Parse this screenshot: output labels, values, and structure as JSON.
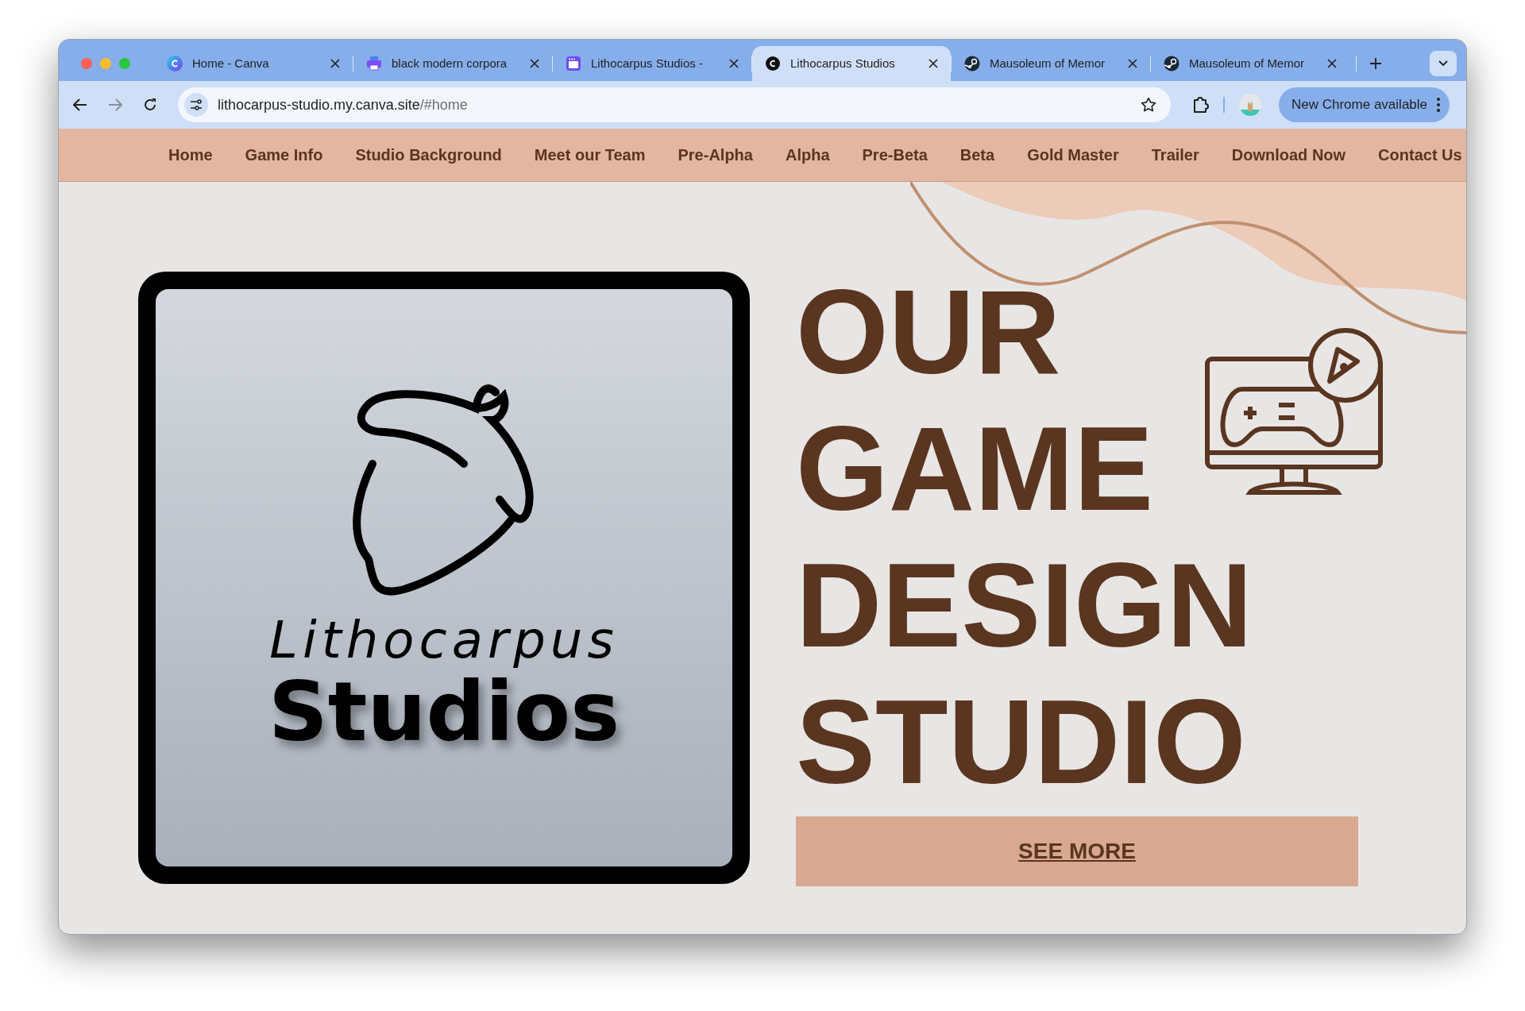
{
  "browser": {
    "tabs": [
      {
        "title": "Home - Canva",
        "kind": "canva",
        "selected": false
      },
      {
        "title": "black modern corpora",
        "kind": "printer",
        "selected": false
      },
      {
        "title": "Lithocarpus Studios -",
        "kind": "window",
        "selected": false
      },
      {
        "title": "Lithocarpus Studios",
        "kind": "circle",
        "selected": true
      },
      {
        "title": "Mausoleum of Memor",
        "kind": "steam",
        "selected": false
      },
      {
        "title": "Mausoleum of Memor",
        "kind": "steam",
        "selected": false
      }
    ],
    "address": {
      "host": "lithocarpus-studio.my.canva.site",
      "path": "/#home"
    },
    "update_button": "New Chrome available"
  },
  "nav": {
    "items": [
      "Home",
      "Game Info",
      "Studio Background",
      "Meet our Team",
      "Pre-Alpha",
      "Alpha",
      "Pre-Beta",
      "Beta",
      "Gold Master",
      "Trailer",
      "Download Now",
      "Contact Us"
    ]
  },
  "hero": {
    "logo_text": [
      "Lithocarpus",
      "Studios"
    ],
    "headline": [
      "OUR",
      "GAME",
      "DESIGN",
      "STUDIO"
    ],
    "button": "SEE MORE"
  }
}
